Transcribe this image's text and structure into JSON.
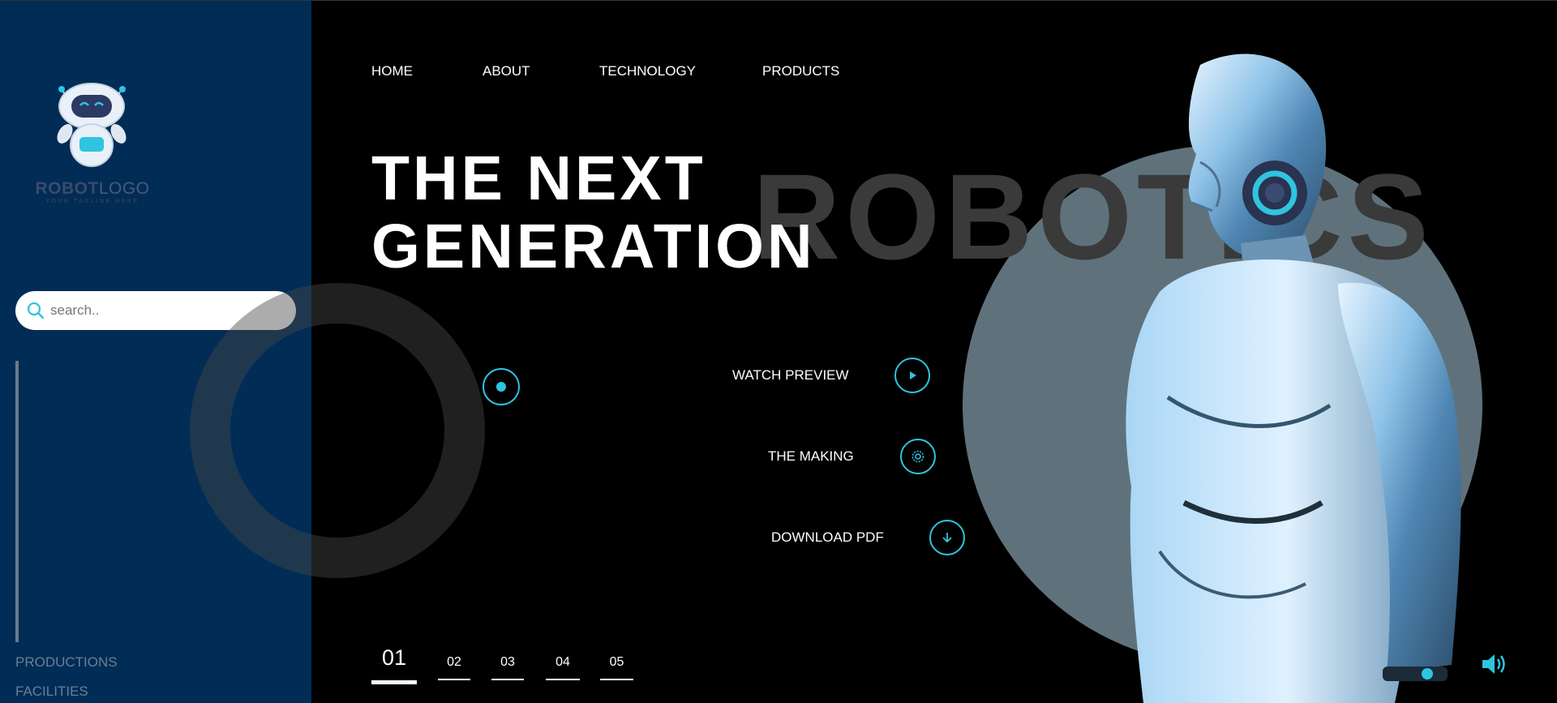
{
  "logo": {
    "word_bold": "ROBOT",
    "word_light": "LOGO",
    "tagline": "YOUR TAGLINE HERE"
  },
  "search": {
    "placeholder": "search.."
  },
  "sidebar": {
    "links": [
      "PRODUCTIONS",
      "FACILITIES"
    ]
  },
  "nav": [
    "HOME",
    "ABOUT",
    "TECHNOLOGY",
    "PRODUCTS"
  ],
  "hero": {
    "headline_line1": "THE NEXT",
    "headline_line2": "GENERATION",
    "background_word": "ROBOTICS"
  },
  "actions": [
    {
      "label": "WATCH PREVIEW",
      "icon": "play-icon"
    },
    {
      "label": "THE MAKING",
      "icon": "gear-icon"
    },
    {
      "label": "DOWNLOAD PDF",
      "icon": "download-arrow-icon"
    }
  ],
  "pagination": {
    "pages": [
      "01",
      "02",
      "03",
      "04",
      "05"
    ],
    "active": "01"
  },
  "colors": {
    "accent": "#2fc4e0",
    "sidebar": "#002c55",
    "circle": "#5f727c",
    "background": "#000000"
  }
}
